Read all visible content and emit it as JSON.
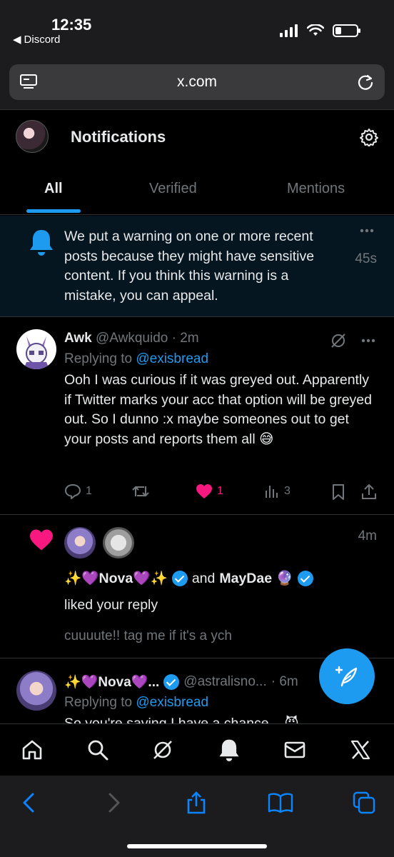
{
  "status_bar": {
    "time": "12:35",
    "back_app": "Discord",
    "battery_level": 0.3
  },
  "browser": {
    "url": "x.com"
  },
  "header": {
    "title": "Notifications"
  },
  "tabs": [
    {
      "label": "All",
      "active": true
    },
    {
      "label": "Verified",
      "active": false
    },
    {
      "label": "Mentions",
      "active": false
    }
  ],
  "notice": {
    "text": "We put a warning on one or more recent posts because they might have sensitive content. If you think this warning is a mistake, you can appeal.",
    "time": "45s"
  },
  "reply_tweet": {
    "name": "Awk",
    "handle": "@Awkquido",
    "time": "· 2m",
    "replying_prefix": "Replying to",
    "replying_to": "@exisbread",
    "body": "Ooh I was curious if it was greyed out. Apparently if Twitter marks your acc that option will be greyed out. So I dunno :x maybe someones out to get your posts and reports them all 😅",
    "replies": "1",
    "likes": "1",
    "views": "3"
  },
  "like_notification": {
    "time": "4m",
    "user1": "✨💜Nova💜✨",
    "conjunction": "and",
    "user2": "MayDae 🔮",
    "action": "liked your reply",
    "preview": "cuuuute!! tag me if it's a ych"
  },
  "next_tweet": {
    "name": "✨💜Nova💜...",
    "handle": "@astralisno...",
    "time": "· 6m",
    "replying_prefix": "Replying to",
    "replying_to": "@exisbread",
    "body": "So you're saying I have a chance... 😈"
  },
  "colors": {
    "accent": "#1d9bf0",
    "like": "#f91880",
    "muted": "#71767b"
  }
}
